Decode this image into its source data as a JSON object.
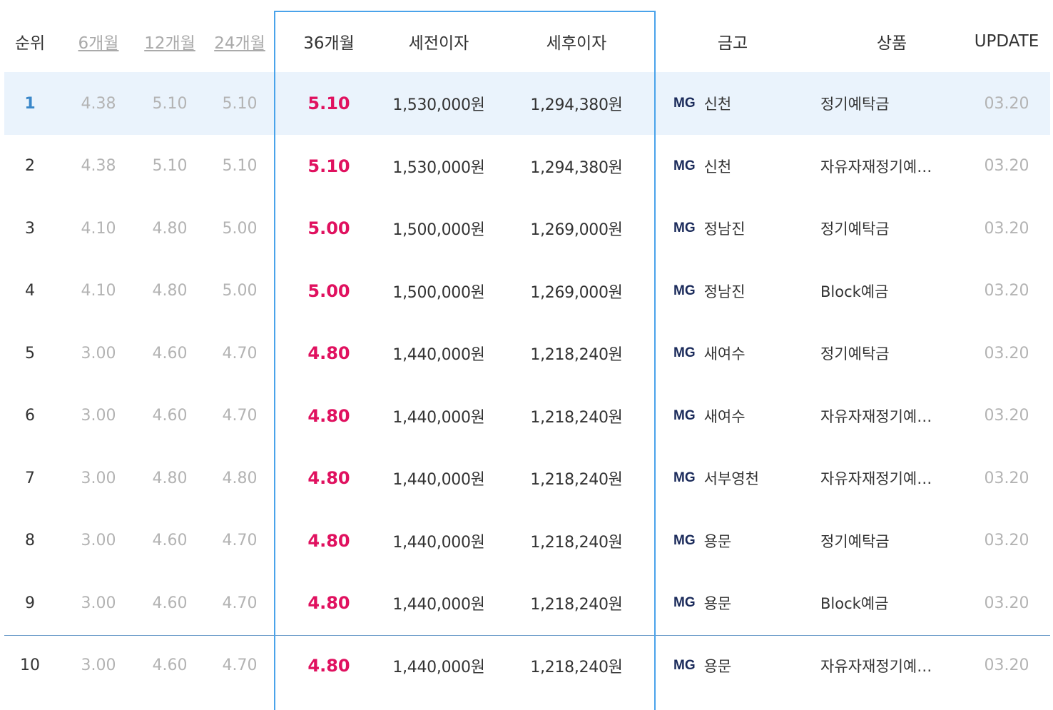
{
  "header": {
    "rank": "순위",
    "m6": "6개월",
    "m12": "12개월",
    "m24": "24개월",
    "m36": "36개월",
    "pre_tax": "세전이자",
    "post_tax": "세후이자",
    "bank": "금고",
    "product": "상품",
    "update": "UPDATE"
  },
  "rows": [
    {
      "rank": "1",
      "m6": "4.38",
      "m12": "5.10",
      "m24": "5.10",
      "m36": "5.10",
      "pre": "1,530,000원",
      "post": "1,294,380원",
      "logo": "MG",
      "bank": "신천",
      "product": "정기예탁금",
      "update": "03.20"
    },
    {
      "rank": "2",
      "m6": "4.38",
      "m12": "5.10",
      "m24": "5.10",
      "m36": "5.10",
      "pre": "1,530,000원",
      "post": "1,294,380원",
      "logo": "MG",
      "bank": "신천",
      "product": "자유자재정기예…",
      "update": "03.20"
    },
    {
      "rank": "3",
      "m6": "4.10",
      "m12": "4.80",
      "m24": "5.00",
      "m36": "5.00",
      "pre": "1,500,000원",
      "post": "1,269,000원",
      "logo": "MG",
      "bank": "정남진",
      "product": "정기예탁금",
      "update": "03.20"
    },
    {
      "rank": "4",
      "m6": "4.10",
      "m12": "4.80",
      "m24": "5.00",
      "m36": "5.00",
      "pre": "1,500,000원",
      "post": "1,269,000원",
      "logo": "MG",
      "bank": "정남진",
      "product": "Block예금",
      "update": "03.20"
    },
    {
      "rank": "5",
      "m6": "3.00",
      "m12": "4.60",
      "m24": "4.70",
      "m36": "4.80",
      "pre": "1,440,000원",
      "post": "1,218,240원",
      "logo": "MG",
      "bank": "새여수",
      "product": "정기예탁금",
      "update": "03.20"
    },
    {
      "rank": "6",
      "m6": "3.00",
      "m12": "4.60",
      "m24": "4.70",
      "m36": "4.80",
      "pre": "1,440,000원",
      "post": "1,218,240원",
      "logo": "MG",
      "bank": "새여수",
      "product": "자유자재정기예…",
      "update": "03.20"
    },
    {
      "rank": "7",
      "m6": "3.00",
      "m12": "4.80",
      "m24": "4.80",
      "m36": "4.80",
      "pre": "1,440,000원",
      "post": "1,218,240원",
      "logo": "MG",
      "bank": "서부영천",
      "product": "자유자재정기예…",
      "update": "03.20"
    },
    {
      "rank": "8",
      "m6": "3.00",
      "m12": "4.60",
      "m24": "4.70",
      "m36": "4.80",
      "pre": "1,440,000원",
      "post": "1,218,240원",
      "logo": "MG",
      "bank": "용문",
      "product": "정기예탁금",
      "update": "03.20"
    },
    {
      "rank": "9",
      "m6": "3.00",
      "m12": "4.60",
      "m24": "4.70",
      "m36": "4.80",
      "pre": "1,440,000원",
      "post": "1,218,240원",
      "logo": "MG",
      "bank": "용문",
      "product": "Block예금",
      "update": "03.20"
    },
    {
      "rank": "10",
      "m6": "3.00",
      "m12": "4.60",
      "m24": "4.70",
      "m36": "4.80",
      "pre": "1,440,000원",
      "post": "1,218,240원",
      "logo": "MG",
      "bank": "용문",
      "product": "자유자재정기예…",
      "update": "03.20"
    }
  ],
  "colors": {
    "rate_highlight": "#e0115f",
    "selected_column_border": "#4aa3ea",
    "selected_row_bg": "#eaf3fc",
    "rank_selected": "#3a87c9"
  }
}
